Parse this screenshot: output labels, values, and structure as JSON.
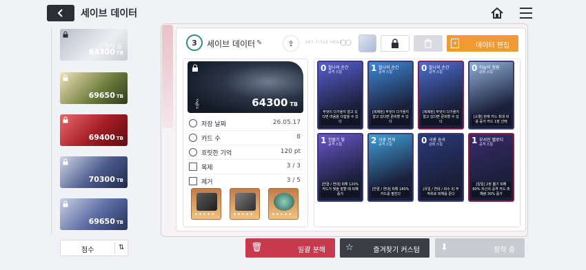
{
  "header": {
    "title": "세이브 데이터",
    "back_icon": "back-arrow-icon",
    "home_icon": "home-icon",
    "menu_icon": "hamburger-menu-icon"
  },
  "slots": [
    {
      "tb": "64300",
      "unit": "TB",
      "status": "장착 중",
      "locked": true
    },
    {
      "tb": "69650",
      "unit": "TB",
      "locked": true
    },
    {
      "tb": "69400",
      "unit": "TB",
      "locked": true
    },
    {
      "tb": "70300",
      "unit": "TB",
      "locked": true
    },
    {
      "tb": "69650",
      "unit": "TB",
      "locked": true
    }
  ],
  "sort": {
    "label": "점수",
    "icon": "sort-order-icon"
  },
  "panel": {
    "level": "3",
    "title": "세이브 데이터",
    "tiny_text": "SET TITLE HERE",
    "edit_label": "데이터 편집"
  },
  "save": {
    "tb": "64300",
    "unit": "TB",
    "stats": [
      {
        "label": "저장 날짜",
        "value": "26.05.17",
        "icon": "clock-icon"
      },
      {
        "label": "카드 수",
        "value": "8",
        "icon": "info-icon"
      },
      {
        "label": "흐릿한 기억",
        "value": "120 pt",
        "icon": "memory-icon"
      },
      {
        "label": "복제",
        "value": "3 / 3",
        "icon": "copy-icon"
      },
      {
        "label": "제거",
        "value": "3 / 5",
        "icon": "remove-icon"
      }
    ]
  },
  "cards": [
    {
      "cost": "0",
      "name": "찰나의 순간",
      "sub": "공격 스킬",
      "desc": "무엇이 다가올지 알고 있다면 마음을 다잡을 수 있다",
      "color": "#5a5ed0",
      "red": false
    },
    {
      "cost": "1",
      "name": "찰나의 순간",
      "sub": "공격 스킬",
      "desc": "[복제된] 무엇이 다가올지 알고 있다면 준비할 수 있다",
      "color": "#3e89d6",
      "red": false
    },
    {
      "cost": "0",
      "name": "찰나의 순간",
      "sub": "공격 스킬",
      "desc": "[복제된] 무엇이 다가올지 알고 있다면 준비할 수 있다",
      "color": "#4c6fd0",
      "red": true
    },
    {
      "cost": "0",
      "name": "하늘의 정원",
      "sub": "강화 스킬",
      "desc": "[소멸] 현재 카드 최대 비용 증가 카드 1장 선택",
      "color": "#8fb0d8",
      "red": false
    },
    {
      "cost": "1",
      "name": "한줄기 빛",
      "sub": "공격 스킬",
      "desc": "[연결 / 연대] 피해 120% 카드가 빛을 발할 때 피해 증가",
      "color": "#6a55c8",
      "red": false
    },
    {
      "cost": "2",
      "name": "극광 전개",
      "sub": "공격 스킬",
      "desc": "[연결 / 연대] 피해 180% 카드를 펼친다",
      "color": "#3fa0d8",
      "red": false
    },
    {
      "cost": "0",
      "name": "극광 송곡",
      "sub": "강화 스킬",
      "desc": "[유일 / 연대 / 회수 3] 무작위로 피해를 준다",
      "color": "#2a3a7a",
      "red": false
    },
    {
      "cost": "1",
      "name": "부서진 멜로디",
      "sub": "공격 스킬",
      "desc": "[일일] 2장 뽑기 피해 60% 자신의 공격 카드 피해량 30% 증가",
      "color": "#3a2a6a",
      "red": true
    }
  ],
  "bottom": {
    "disassemble": "일괄 분해",
    "favorite": "즐겨찾기 커스텀",
    "equip": "장착 중"
  }
}
